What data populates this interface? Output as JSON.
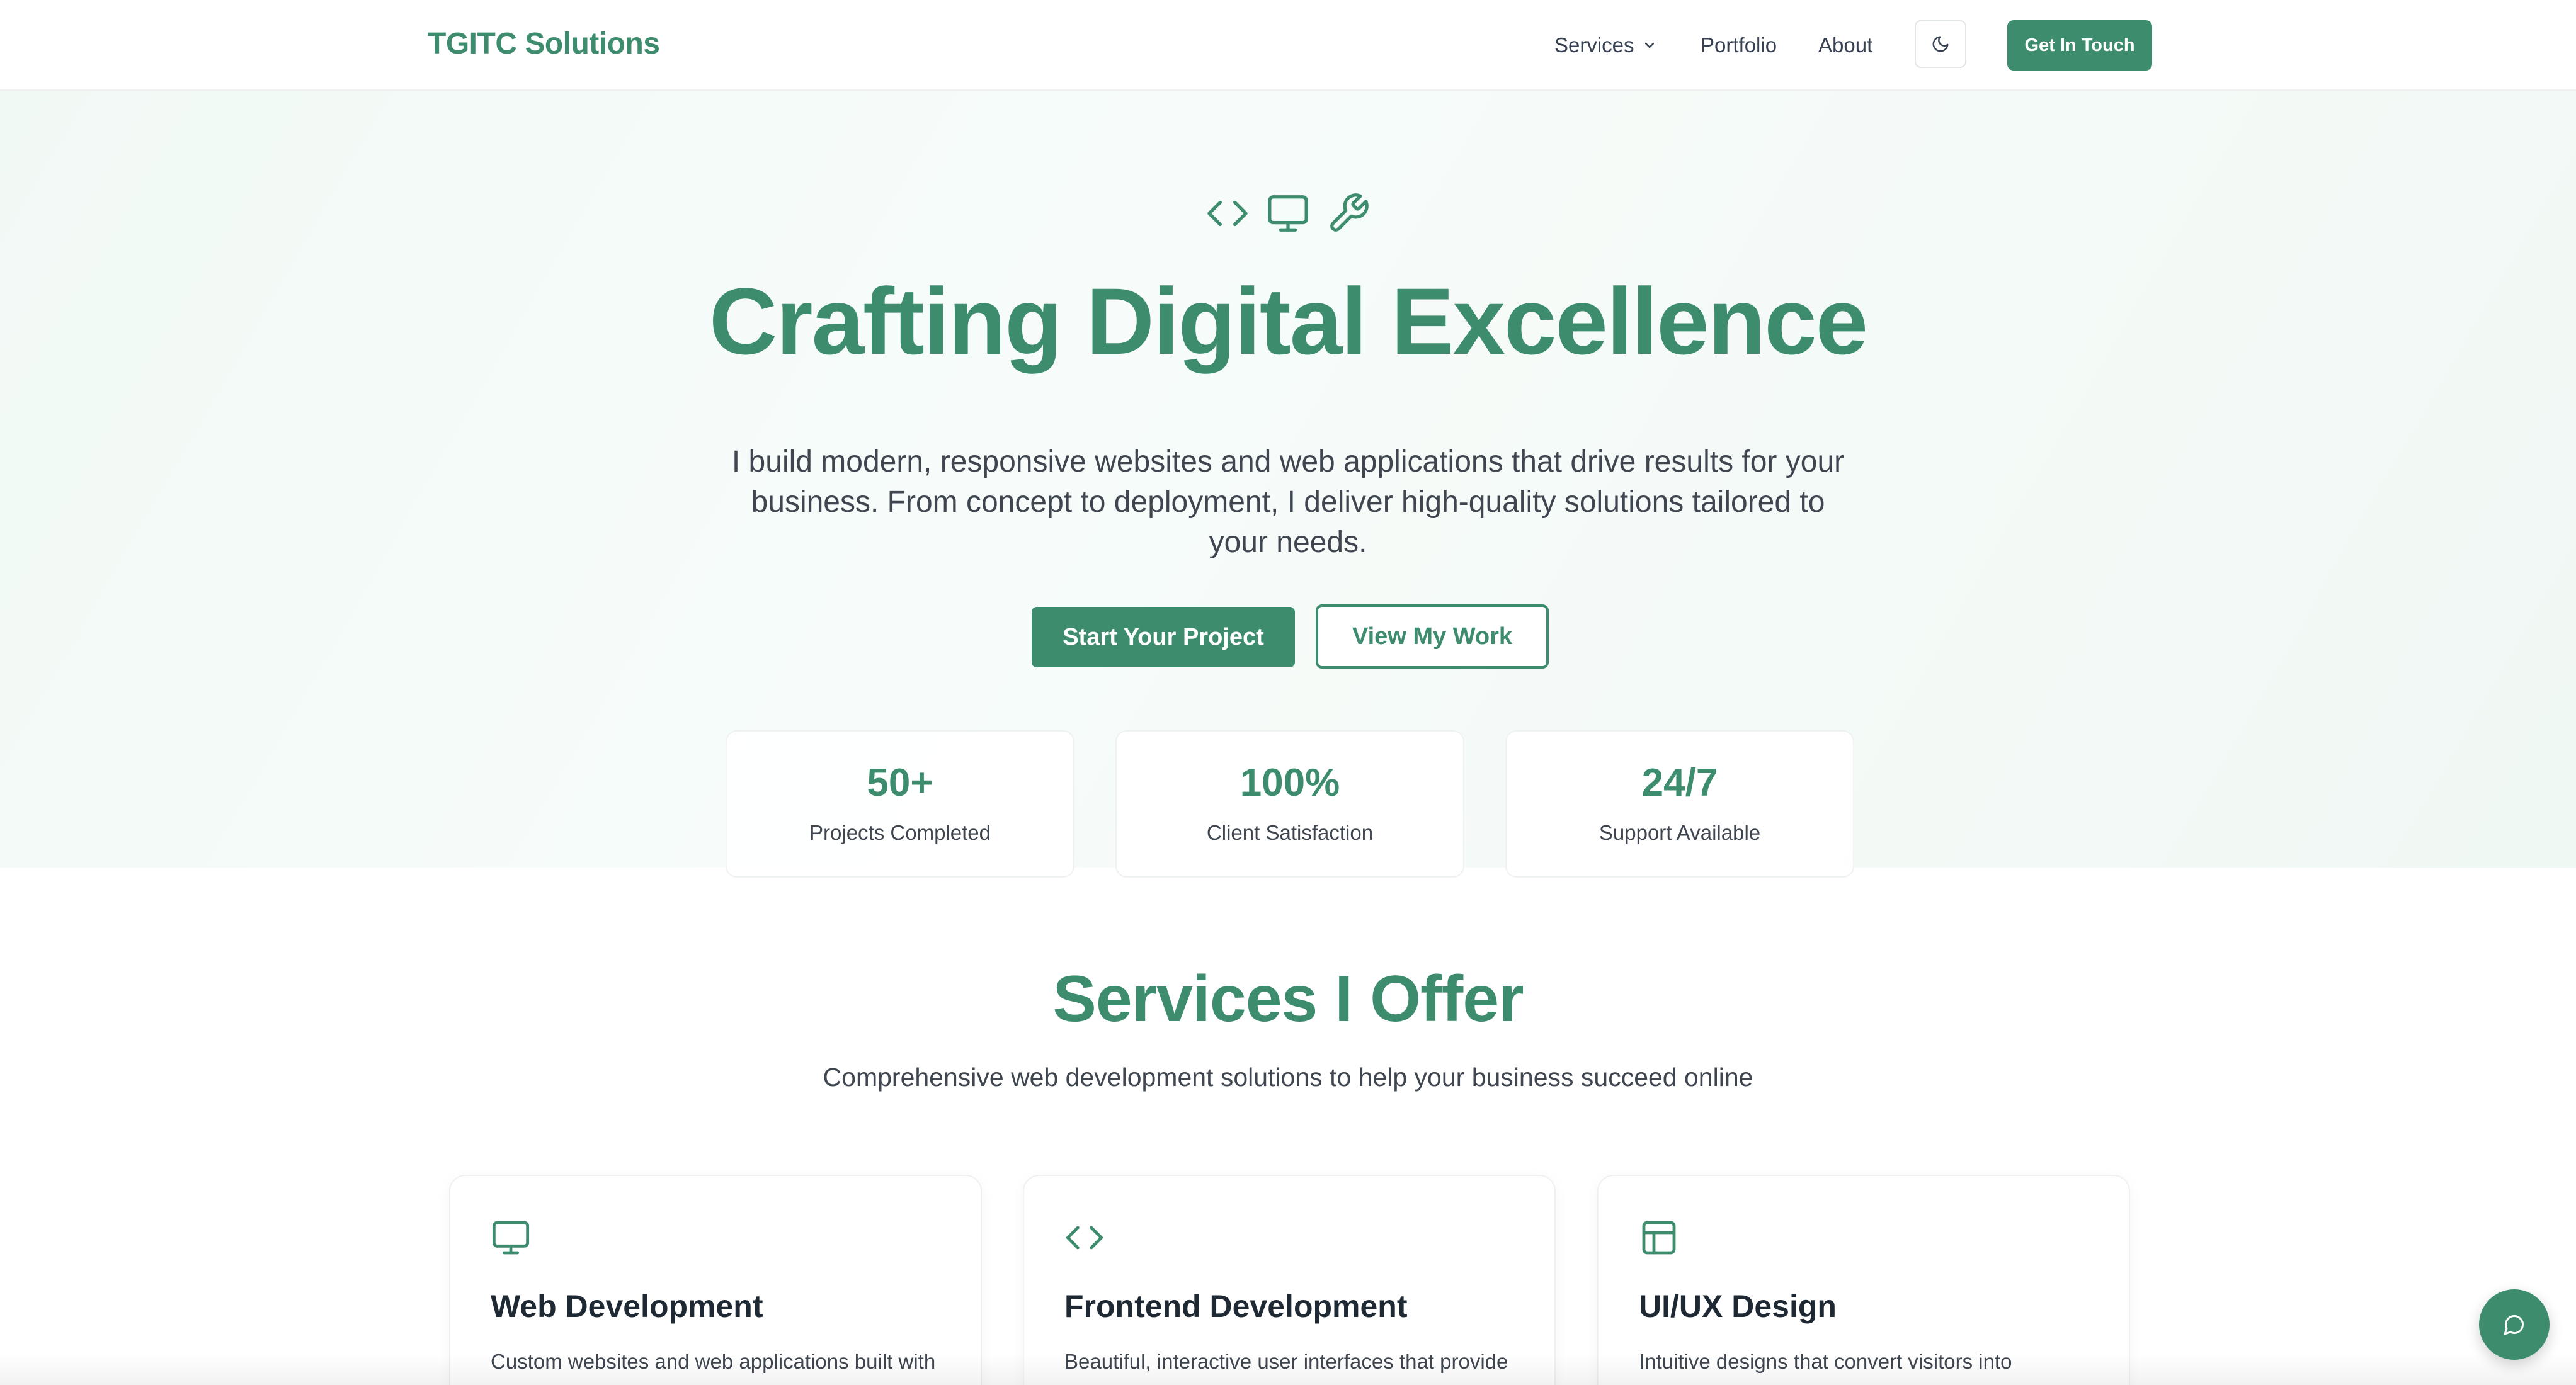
{
  "nav": {
    "brand": "TGITC Solutions",
    "links": [
      {
        "label": "Services"
      },
      {
        "label": "Portfolio"
      },
      {
        "label": "About"
      }
    ],
    "theme_toggle_icon": "moon-icon",
    "cta_label": "Get In Touch"
  },
  "hero": {
    "icons": [
      "code-icon",
      "monitor-icon",
      "wrench-icon"
    ],
    "title": "Crafting Digital Excellence",
    "description": "I build modern, responsive websites and web applications that drive results for your business. From concept to deployment, I deliver high-quality solutions tailored to your needs.",
    "primary_button": "Start Your Project",
    "secondary_button": "View My Work",
    "stats": [
      {
        "value": "50+",
        "label": "Projects Completed"
      },
      {
        "value": "100%",
        "label": "Client Satisfaction"
      },
      {
        "value": "24/7",
        "label": "Support Available"
      }
    ]
  },
  "services": {
    "title": "Services I Offer",
    "subtitle": "Comprehensive web development solutions to help your business succeed online",
    "cards": [
      {
        "icon": "monitor-icon",
        "title": "Web Development",
        "description": "Custom websites and web applications built with"
      },
      {
        "icon": "code-icon",
        "title": "Frontend Development",
        "description": "Beautiful, interactive user interfaces that provide"
      },
      {
        "icon": "layout-icon",
        "title": "UI/UX Design",
        "description": "Intuitive designs that convert visitors into"
      }
    ]
  },
  "chat": {
    "icon": "chat-bubble-icon"
  },
  "colors": {
    "accent": "#3d8c6e",
    "text": "#1f2933",
    "muted": "#3f4650"
  }
}
